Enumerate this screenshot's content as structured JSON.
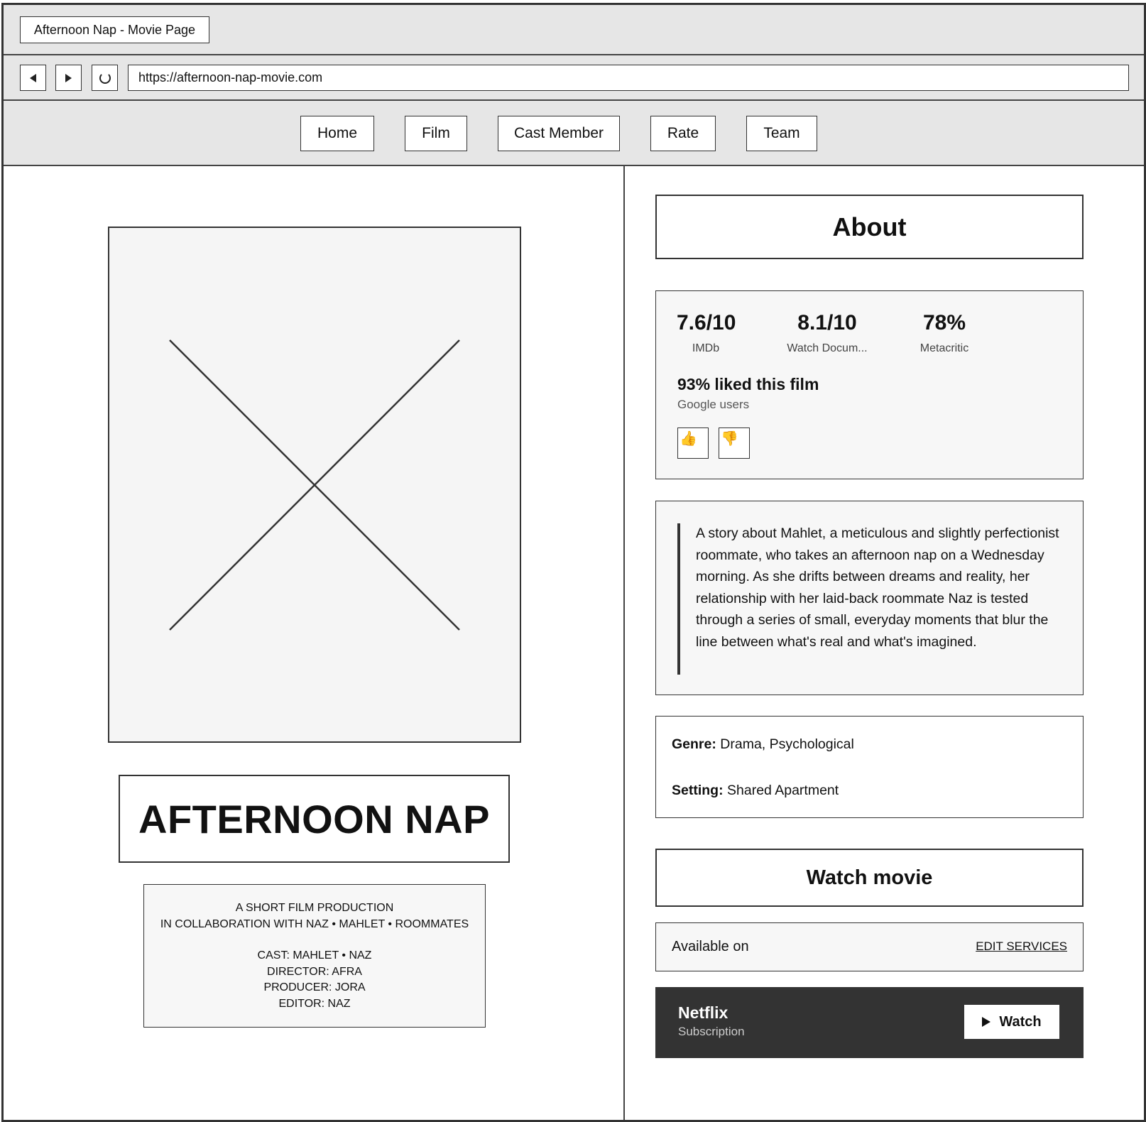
{
  "browser": {
    "tab_title": "Afternoon Nap - Movie Page",
    "url": "https://afternoon-nap-movie.com"
  },
  "nav": {
    "items": [
      "Home",
      "Film",
      "Cast Member",
      "Rate",
      "Team"
    ]
  },
  "movie": {
    "title": "AFTERNOON NAP",
    "credits": {
      "line1": "A SHORT FILM PRODUCTION",
      "line2": "IN COLLABORATION WITH NAZ • MAHLET • ROOMMATES",
      "cast": "CAST: MAHLET • NAZ",
      "director": "DIRECTOR: AFRA",
      "producer": "PRODUCER: JORA",
      "editor": "EDITOR: NAZ"
    }
  },
  "about": {
    "heading": "About",
    "ratings": [
      {
        "value": "7.6/10",
        "source": "IMDb"
      },
      {
        "value": "8.1/10",
        "source": "Watch Docum..."
      },
      {
        "value": "78%",
        "source": "Metacritic"
      }
    ],
    "liked": "93% liked this film",
    "liked_source": "Google users",
    "thumbs_up": "👍",
    "thumbs_down": "👎",
    "synopsis": "A story about Mahlet, a meticulous and slightly perfectionist roommate, who takes an afternoon nap on a Wednesday morning. As she drifts between dreams and reality, her relationship with her laid-back roommate Naz is tested through a series of small, everyday moments that blur the line between what's real and what's imagined.",
    "genre_label": "Genre:",
    "genre_value": "Drama, Psychological",
    "setting_label": "Setting:",
    "setting_value": "Shared Apartment"
  },
  "watch": {
    "heading": "Watch movie",
    "available_label": "Available on",
    "edit_services": "EDIT SERVICES",
    "provider_name": "Netflix",
    "provider_kind": "Subscription",
    "watch_label": "Watch"
  }
}
